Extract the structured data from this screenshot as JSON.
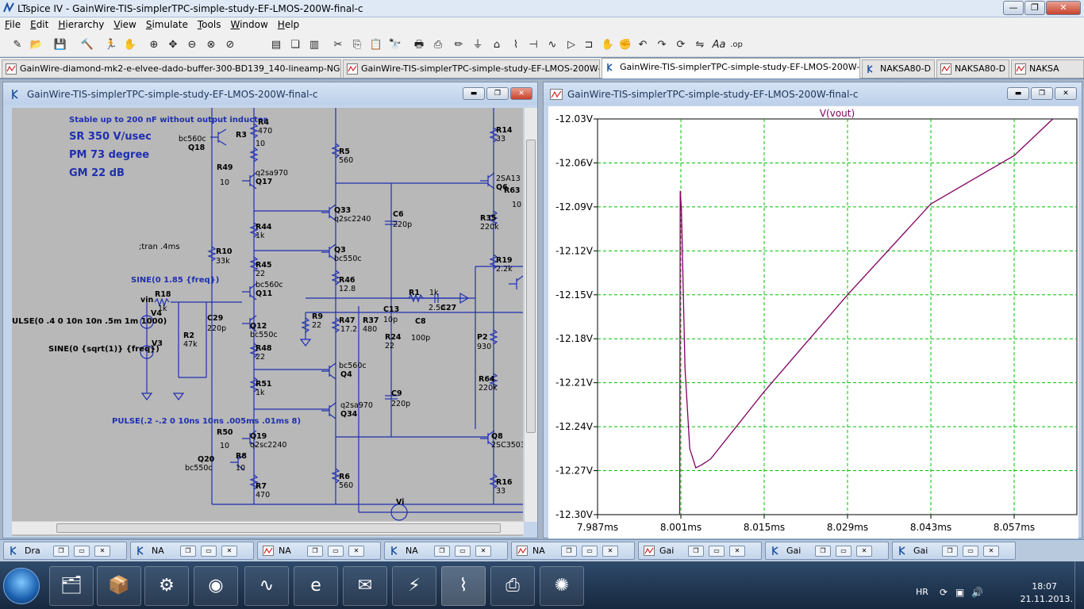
{
  "app": {
    "title": "LTspice IV - GainWire-TIS-simplerTPC-simple-study-EF-LMOS-200W-final-c"
  },
  "menu": [
    {
      "label": "File",
      "accel": "F"
    },
    {
      "label": "Edit",
      "accel": "E"
    },
    {
      "label": "Hierarchy",
      "accel": "H"
    },
    {
      "label": "View",
      "accel": "V"
    },
    {
      "label": "Simulate",
      "accel": "S"
    },
    {
      "label": "Tools",
      "accel": "T"
    },
    {
      "label": "Window",
      "accel": "W"
    },
    {
      "label": "Help",
      "accel": "H"
    }
  ],
  "toolbar_icons": [
    "new-schematic-icon",
    "open-icon",
    "save-icon",
    "control-panel-icon",
    "run-icon",
    "halt-icon",
    "zoom-in-icon",
    "pan-icon",
    "zoom-out-icon",
    "zoom-fit-icon",
    "autorange-icon",
    "tile-horizontal-icon",
    "cascade-icon",
    "tile-vertical-icon",
    "cut-icon",
    "copy-icon",
    "find-icon",
    "print-setup-icon",
    "print-icon",
    "draw-wire-icon",
    "ground-icon",
    "label-net-icon",
    "resistor-icon",
    "capacitor-icon",
    "inductor-icon",
    "diode-icon",
    "component-icon",
    "move-icon",
    "drag-icon",
    "undo-icon",
    "redo-icon",
    "rotate-icon",
    "mirror-icon",
    "text-icon",
    "spice-directive-icon"
  ],
  "tabs": [
    {
      "label": "GainWire-diamond-mk2-e-elvee-dado-buffer-300-BD139_140-lineamp-NGFB+-15V-d",
      "icon": "waveform-icon"
    },
    {
      "label": "GainWire-TIS-simplerTPC-simple-study-EF-LMOS-200W-final-c",
      "icon": "waveform-icon"
    },
    {
      "label": "GainWire-TIS-simplerTPC-simple-study-EF-LMOS-200W-final-c",
      "icon": "schematic-icon"
    },
    {
      "label": "NAKSA80-D",
      "icon": "schematic-icon"
    },
    {
      "label": "NAKSA80-D",
      "icon": "waveform-icon"
    },
    {
      "label": "NAKSA",
      "icon": "waveform-icon"
    }
  ],
  "schematic": {
    "title": "GainWire-TIS-simplerTPC-simple-study-EF-LMOS-200W-final-c",
    "notes": {
      "stable": "Stable up to 200 nF without output inductor",
      "sr": "SR 350 V/usec",
      "pm": "PM  73 degree",
      "gm": "GM  22 dB",
      "tran": ";tran .4ms",
      "sine_freq": "SINE(0 1.85 {freq})",
      "pulse_v4": "ULSE(0 .4 0 10n 10n .5m 1m 1000)",
      "sine_v3": "SINE(0 {sqrt(1)} {freq})",
      "pulse2": "PULSE(.2 -.2 0 10ns 10ns .005ms .01ms 8)"
    },
    "labels": [
      "bc560c",
      "Q18",
      "R3",
      "10",
      "R4",
      "470",
      "R49",
      "10",
      "q2sa970",
      "Q17",
      "R5",
      "560",
      "R14",
      "33",
      "2SA13",
      "Q6",
      "R63",
      "10",
      "Q33",
      "q2sc2240",
      "C6",
      "220p",
      "R35",
      "220k",
      "R44",
      "1k",
      "Q3",
      "bc550c",
      "R19",
      "2.2k",
      "R10",
      "33k",
      "R45",
      "22",
      "R46",
      "12.8",
      "bc560c",
      "Q11",
      "vin",
      "R18",
      "1k",
      "R1",
      "1k",
      "C27",
      "2.5n",
      "V4",
      "C29",
      "220p",
      "R2",
      "47k",
      "R9",
      "22",
      "R47",
      "17.2",
      "C13",
      "10p",
      "R37",
      "480",
      "C8",
      "100p",
      "Q12",
      "bc550c",
      "R24",
      "22",
      "P2",
      "930",
      "V3",
      "R48",
      "22",
      "bc560c",
      "Q4",
      "R64",
      "220k",
      "R51",
      "1k",
      "q2sa970",
      "Q34",
      "C9",
      "220p",
      "R50",
      "10",
      "Q19",
      "q2sc2240",
      "Q8",
      "2SC3503",
      "Q20",
      "bc550c",
      "R8",
      "10",
      "R7",
      "470",
      "R6",
      "560",
      "R16",
      "33",
      "Vi"
    ]
  },
  "waveform": {
    "title": "GainWire-TIS-simplerTPC-simple-study-EF-LMOS-200W-final-c",
    "trace_label": "V(vout)",
    "trace_color": "#800060",
    "grid_color": "#00c000",
    "y_ticks": [
      "-12.03V",
      "-12.06V",
      "-12.09V",
      "-12.12V",
      "-12.15V",
      "-12.18V",
      "-12.21V",
      "-12.24V",
      "-12.27V",
      "-12.30V"
    ],
    "x_ticks": [
      "7.987ms",
      "8.001ms",
      "8.015ms",
      "8.029ms",
      "8.043ms",
      "8.057ms"
    ]
  },
  "chart_data": {
    "type": "line",
    "title": "V(vout)",
    "xlabel": "",
    "ylabel": "",
    "xlim": [
      7.987,
      8.064
    ],
    "ylim": [
      -12.3,
      -12.03
    ],
    "grid": true,
    "series": [
      {
        "name": "V(vout)",
        "x": [
          7.987,
          8.0005,
          8.0008,
          8.0009,
          8.0011,
          8.0013,
          8.0017,
          8.0025,
          8.0035,
          8.0045,
          8.006,
          8.015,
          8.029,
          8.043,
          8.057,
          8.0635
        ],
        "y": [
          null,
          null,
          -12.3,
          -12.079,
          -12.092,
          -12.13,
          -12.2,
          -12.255,
          -12.268,
          -12.266,
          -12.262,
          -12.216,
          -12.15,
          -12.088,
          -12.055,
          -12.03
        ]
      }
    ]
  },
  "mini_windows": [
    {
      "label": "Dra",
      "icon": "schematic-icon"
    },
    {
      "label": "NA",
      "icon": "schematic-icon"
    },
    {
      "label": "NA",
      "icon": "waveform-icon"
    },
    {
      "label": "NA",
      "icon": "schematic-icon"
    },
    {
      "label": "NA",
      "icon": "waveform-icon"
    },
    {
      "label": "Gai",
      "icon": "waveform-icon"
    },
    {
      "label": "Gai",
      "icon": "schematic-icon"
    },
    {
      "label": "Gai",
      "icon": "schematic-icon"
    }
  ],
  "taskbar": {
    "apps": [
      "explorer-icon",
      "installer-icon",
      "settings-icon",
      "antivirus-icon",
      "oscilloscope-icon",
      "internet-explorer-icon",
      "mail-icon",
      "winamp-icon",
      "ltspice-icon",
      "pdf-reader-icon",
      "paint-splat-icon"
    ],
    "lang": "HR",
    "time": "18:07",
    "date": "21.11.2013."
  }
}
